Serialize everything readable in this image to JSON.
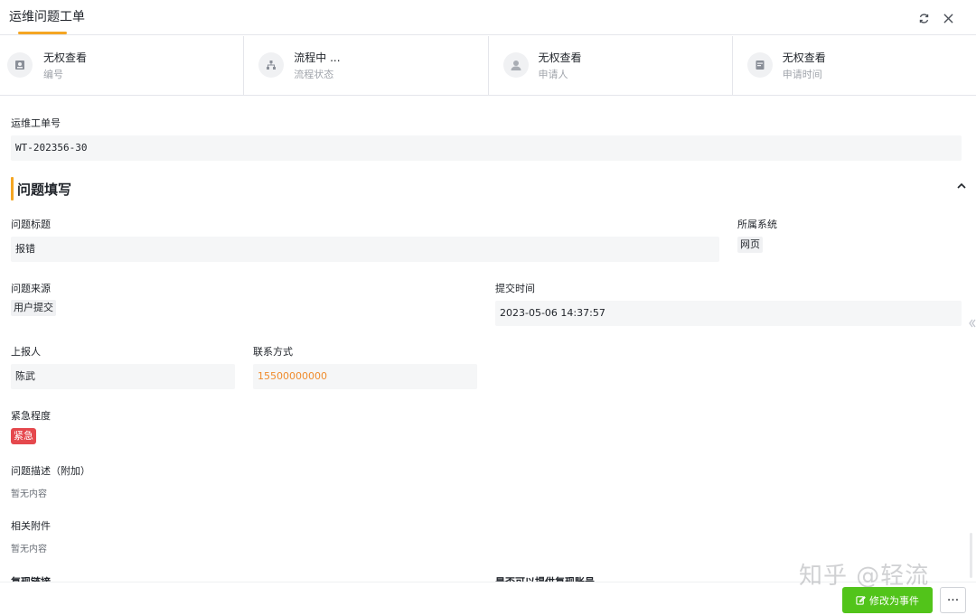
{
  "window": {
    "title": "运维问题工单"
  },
  "summary": [
    {
      "value": "无权查看",
      "label": "编号",
      "icon": "id-card-icon"
    },
    {
      "value": "流程中 ...",
      "label": "流程状态",
      "icon": "workflow-icon"
    },
    {
      "value": "无权查看",
      "label": "申请人",
      "icon": "user-icon"
    },
    {
      "value": "无权查看",
      "label": "申请时间",
      "icon": "calendar-icon"
    }
  ],
  "ticket": {
    "label": "运维工单号",
    "value": "WT-202356-30"
  },
  "section": {
    "title": "问题填写"
  },
  "form": {
    "issue_title": {
      "label": "问题标题",
      "value": "报错"
    },
    "system": {
      "label": "所属系统",
      "value": "网页"
    },
    "source": {
      "label": "问题来源",
      "value": "用户提交"
    },
    "submit_time": {
      "label": "提交时间",
      "value": "2023-05-06 14:37:57"
    },
    "reporter": {
      "label": "上报人",
      "value": "陈武"
    },
    "contact": {
      "label": "联系方式",
      "value": "15500000000"
    },
    "urgency": {
      "label": "紧急程度",
      "value": "紧急"
    },
    "description": {
      "label": "问题描述（附加）",
      "value": "暂无内容"
    },
    "attachments": {
      "label": "相关附件",
      "value": "暂无内容"
    },
    "repro_link": {
      "label": "复现链接"
    },
    "repro_account": {
      "label": "是否可以提供复现账号"
    }
  },
  "footer": {
    "primary_label": "修改为事件",
    "more_label": "···"
  },
  "watermark": "知乎 @轻流",
  "colors": {
    "accent": "#f5a623",
    "primary": "#52c41a",
    "danger": "#e5484d",
    "phone": "#f08c2e"
  }
}
